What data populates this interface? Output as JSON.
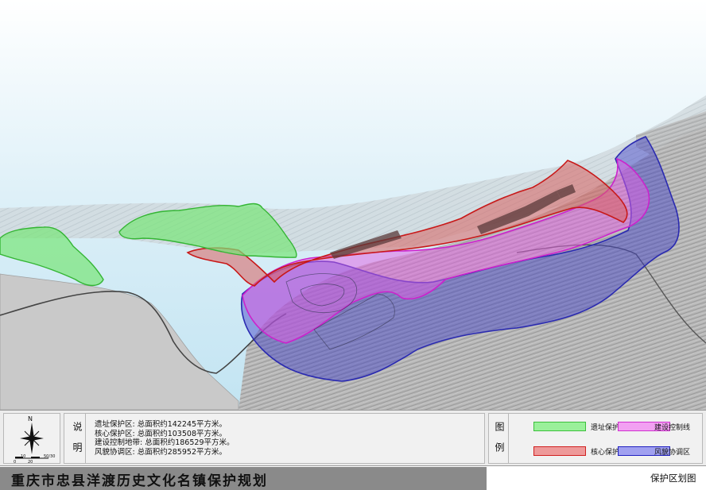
{
  "map": {
    "colors": {
      "relic_zone": "#78e678",
      "core_zone": "#d9605e",
      "control_zone": "#e45ee4",
      "landscape_zone": "#3c3cc8",
      "water": "#c8e8f4",
      "terrain": "#bdbdbd"
    }
  },
  "description": {
    "heading": "说明",
    "lines": [
      "遗址保护区: 总面积约142245平方米。",
      "核心保护区: 总面积约103508平方米。",
      "建设控制地带: 总面积约186529平方米。",
      "风貌协调区: 总面积约285952平方米。"
    ]
  },
  "compass": {
    "north": "N",
    "scale_ticks": [
      "0",
      "10",
      "20",
      "50/30"
    ]
  },
  "legend": {
    "heading": "图例",
    "items": [
      {
        "label": "遗址保护区",
        "fill": "#9af09a",
        "stroke": "#3cc03c"
      },
      {
        "label": "建设控制线",
        "fill": "#f2a0f2",
        "stroke": "#d030d0"
      },
      {
        "label": "核心保护区",
        "fill": "#ee9a9a",
        "stroke": "#d02020"
      },
      {
        "label": "风貌协调区",
        "fill": "#a0a0f0",
        "stroke": "#2020c0"
      }
    ]
  },
  "footer": {
    "title": "重庆市忠县洋渡历史文化名镇保护规划",
    "subtitle": "保护区划图"
  }
}
